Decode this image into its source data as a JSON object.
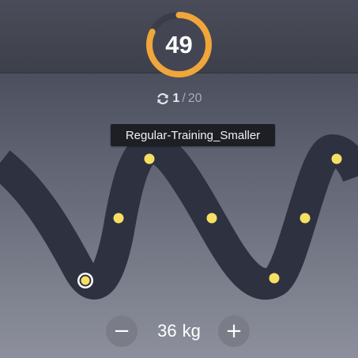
{
  "score": {
    "value": "49",
    "ring_progress": 0.82,
    "ring_color": "#f0a63a",
    "track_color": "#3a3d48"
  },
  "reps": {
    "icon": "refresh-icon",
    "current": "1",
    "separator": "/",
    "total": "20"
  },
  "tooltip": {
    "text": "Regular-Training_Smaller"
  },
  "wave": {
    "track_color": "#2d3140",
    "dot_color": "#f7df63",
    "active_dot_ring_color": "#ffffff",
    "active_dot": 1,
    "dots": 7
  },
  "weight": {
    "value": "36",
    "unit": "kg",
    "minus_label": "−",
    "plus_label": "+"
  }
}
